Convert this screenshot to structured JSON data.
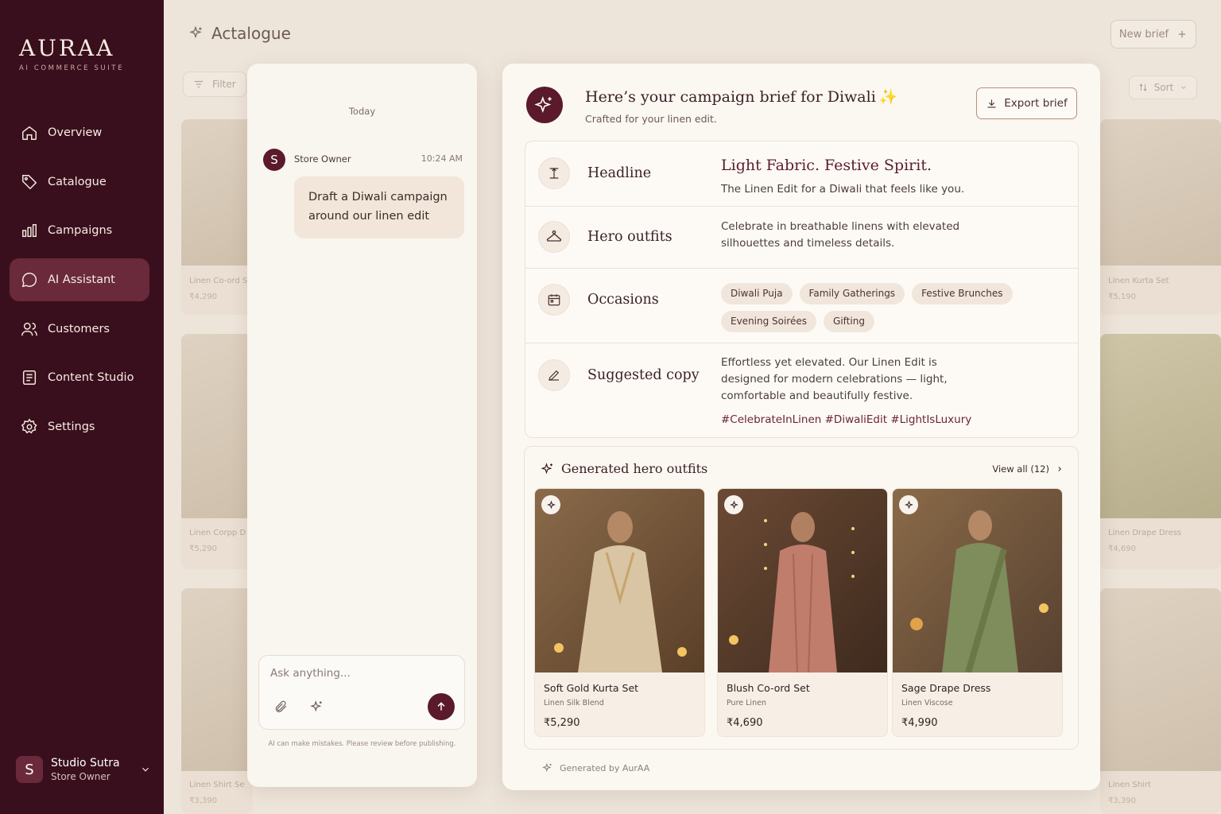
{
  "brand": {
    "name": "AURAA",
    "tagline": "AI COMMERCE SUITE"
  },
  "sidebar": {
    "items": [
      {
        "label": "Overview",
        "icon": "home-icon"
      },
      {
        "label": "Catalogue",
        "icon": "tag-icon"
      },
      {
        "label": "Campaigns",
        "icon": "bar-chart-icon"
      },
      {
        "label": "AI Assistant",
        "icon": "chat-bubble-icon",
        "active": true
      },
      {
        "label": "Customers",
        "icon": "users-icon"
      },
      {
        "label": "Content Studio",
        "icon": "document-icon"
      },
      {
        "label": "Settings",
        "icon": "gear-icon"
      }
    ],
    "profile": {
      "initial": "S",
      "name": "Studio Sutra",
      "role": "Store Owner"
    }
  },
  "background": {
    "title": "Actalogue",
    "new_brief": "New brief",
    "filter": "Filter",
    "sort": "Sort",
    "cards": [
      {
        "title": "Linen Co-ord S",
        "price": "₹4,290"
      },
      {
        "title": "Linen Corpp D",
        "price": "₹5,290"
      },
      {
        "title": "Linen Shirt Se",
        "price": "₹3,390"
      },
      {
        "title": "Linen Kurta Set",
        "price": "₹5,190"
      },
      {
        "title": "Linen Drape Dress",
        "price": "₹4,690"
      },
      {
        "title": "Linen Shirt",
        "price": "₹3,390"
      }
    ]
  },
  "chat": {
    "day": "Today",
    "sender_initial": "S",
    "sender": "Store Owner",
    "time": "10:24 AM",
    "message": "Draft a Diwali campaign around our linen edit",
    "placeholder": "Ask anything...",
    "disclaimer": "AI can make mistakes. Please review before publishing."
  },
  "brief": {
    "title": "Here’s your campaign brief for Diwali",
    "title_spark": "✨",
    "subtitle": "Crafted for your linen edit.",
    "export_label": "Export brief",
    "headline": {
      "label": "Headline",
      "title": "Light Fabric. Festive Spirit.",
      "sub": "The Linen Edit for a Diwali that feels like you."
    },
    "hero": {
      "label": "Hero outfits",
      "text": "Celebrate in breathable linens with elevated silhouettes and timeless details."
    },
    "occasions": {
      "label": "Occasions",
      "chips": [
        "Diwali Puja",
        "Family Gatherings",
        "Festive Brunches",
        "Evening Soirées",
        "Gifting"
      ]
    },
    "copy": {
      "label": "Suggested copy",
      "text": "Effortless yet elevated. Our Linen Edit is designed for modern celebrations — light, comfortable and beautifully festive.",
      "hashtags": "#CelebrateInLinen #DiwaliEdit #LightIsLuxury"
    },
    "generated": {
      "title": "Generated hero outfits",
      "view_all": "View all (12)",
      "footer": "Generated by AurAA",
      "cards": [
        {
          "name": "Soft Gold Kurta Set",
          "fabric": "Linen Silk Blend",
          "price": "₹5,290"
        },
        {
          "name": "Blush Co-ord Set",
          "fabric": "Pure Linen",
          "price": "₹4,690"
        },
        {
          "name": "Sage Drape Dress",
          "fabric": "Linen Viscose",
          "price": "₹4,990"
        }
      ]
    }
  },
  "colors": {
    "sidebar_bg": "#3a0f1d",
    "accent": "#5a1a2b",
    "active_nav": "#6a2a3b",
    "spark": "#e3b744"
  }
}
